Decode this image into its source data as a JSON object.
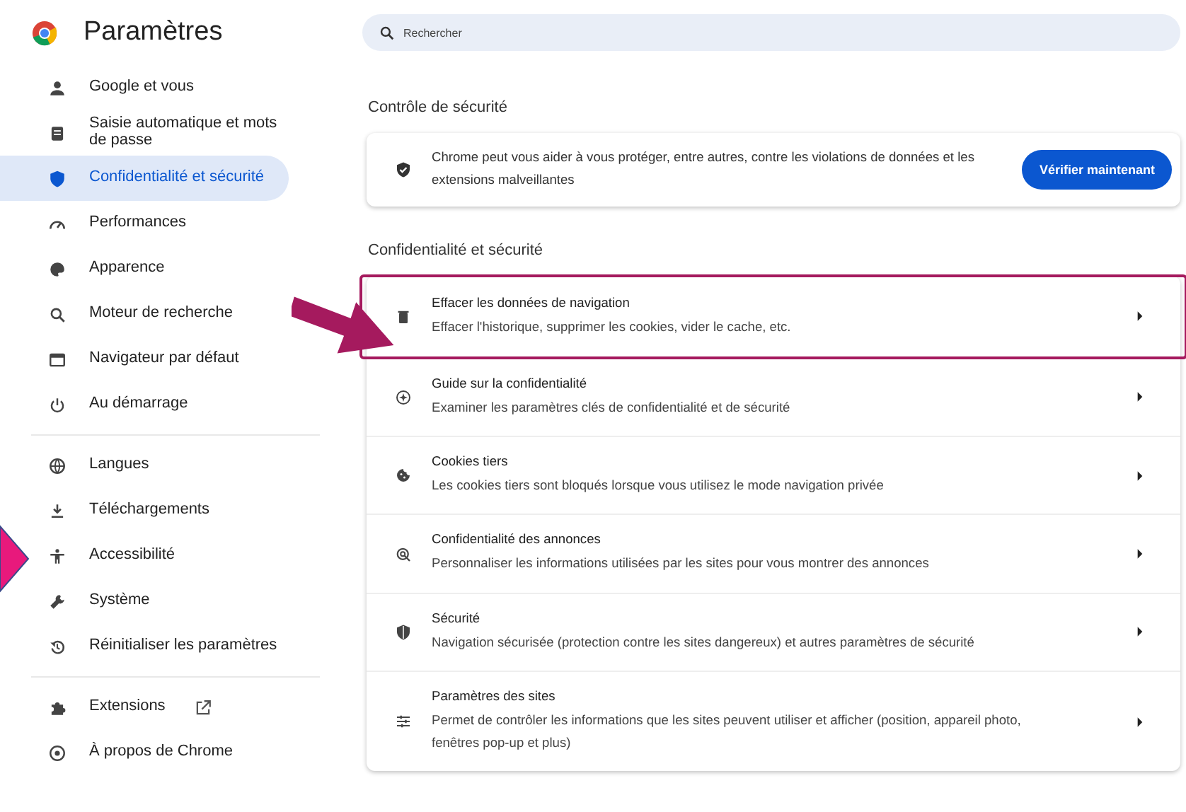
{
  "header": {
    "title": "Paramètres"
  },
  "search": {
    "placeholder": "Rechercher"
  },
  "sidebar": {
    "groups": [
      {
        "items": [
          {
            "label": "Google et vous",
            "selected": false
          },
          {
            "label": "Saisie automatique et mots de passe",
            "selected": false
          },
          {
            "label": "Confidentialité et sécurité",
            "selected": true
          },
          {
            "label": "Performances",
            "selected": false
          },
          {
            "label": "Apparence",
            "selected": false
          },
          {
            "label": "Moteur de recherche",
            "selected": false
          },
          {
            "label": "Navigateur par défaut",
            "selected": false
          },
          {
            "label": "Au démarrage",
            "selected": false
          }
        ]
      },
      {
        "items": [
          {
            "label": "Langues",
            "selected": false
          },
          {
            "label": "Téléchargements",
            "selected": false
          },
          {
            "label": "Accessibilité",
            "selected": false
          },
          {
            "label": "Système",
            "selected": false
          },
          {
            "label": "Réinitialiser les paramètres",
            "selected": false
          }
        ]
      },
      {
        "items": [
          {
            "label": "Extensions",
            "selected": false,
            "external": true
          },
          {
            "label": "À propos de Chrome",
            "selected": false
          }
        ]
      }
    ]
  },
  "safety_check": {
    "heading": "Contrôle de sécurité",
    "text": "Chrome peut vous aider à vous protéger, entre autres, contre les violations de données et les extensions malveillantes",
    "button": "Vérifier maintenant"
  },
  "privacy": {
    "heading": "Confidentialité et sécurité",
    "rows": [
      {
        "title": "Effacer les données de navigation",
        "subtitle": "Effacer l'historique, supprimer les cookies, vider le cache, etc.",
        "highlighted": true
      },
      {
        "title": "Guide sur la confidentialité",
        "subtitle": "Examiner les paramètres clés de confidentialité et de sécurité",
        "highlighted": false
      },
      {
        "title": "Cookies tiers",
        "subtitle": "Les cookies tiers sont bloqués lorsque vous utilisez le mode navigation privée",
        "highlighted": false
      },
      {
        "title": "Confidentialité des annonces",
        "subtitle": "Personnaliser les informations utilisées par les sites pour vous montrer des annonces",
        "highlighted": false
      },
      {
        "title": "Sécurité",
        "subtitle": "Navigation sécurisée (protection contre les sites dangereux) et autres paramètres de sécurité",
        "highlighted": false
      },
      {
        "title": "Paramètres des sites",
        "subtitle": "Permet de contrôler les informations que les sites peuvent utiliser et afficher (position, appareil photo, fenêtres pop-up et plus)",
        "highlighted": false
      }
    ]
  }
}
